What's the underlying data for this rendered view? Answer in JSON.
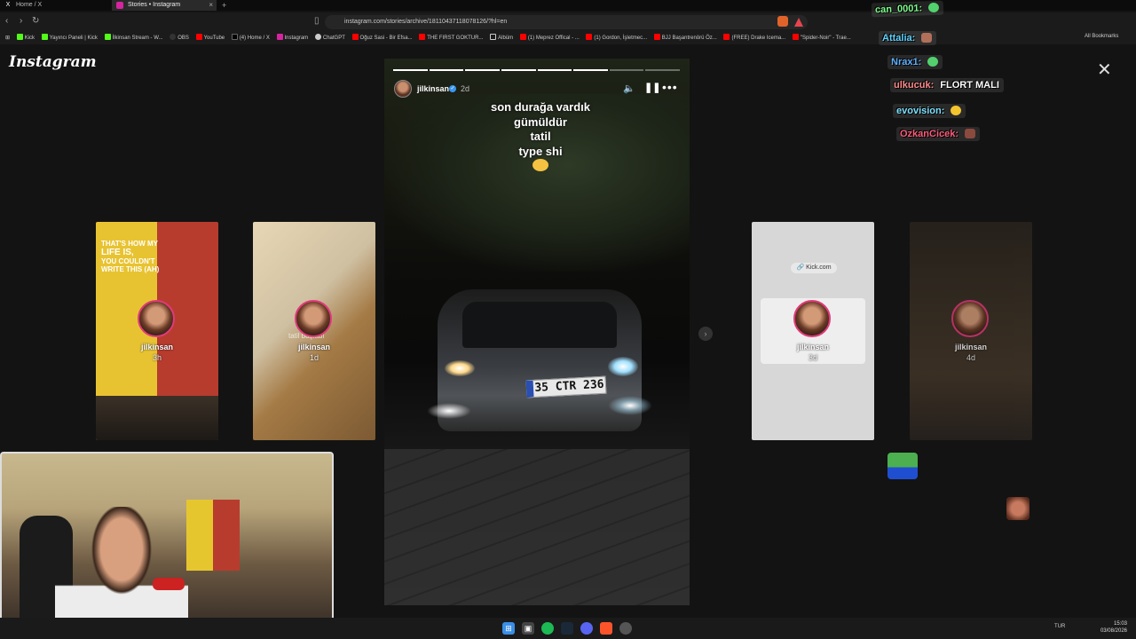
{
  "browser": {
    "tabs": [
      {
        "label": "Home / X",
        "icon": "x-logo-icon"
      },
      {
        "label": "Stories • Instagram",
        "icon": "instagram-icon"
      }
    ],
    "new_tab": "+",
    "url": "instagram.com/stories/archive/18110437118078126/?hl=en",
    "bookmarks": [
      "Kick",
      "Yayıncı Paneli | Kick",
      "İlkinsan Stream - W...",
      "OBS",
      "YouTube",
      "(4) Home / X",
      "Instagram",
      "ChatGPT",
      "Oğuz Sasi - Bir Efsa...",
      "THE FIRST GOKTUR...",
      "Albüm",
      "(1) Meprez Offical - ...",
      "(1) Gordon, İşletmec...",
      "BJJ Başantrenörü Öz...",
      "(FREE) Drake Icema...",
      "\"Spider-Noir\" - Trae..."
    ],
    "all_bookmarks": "All Bookmarks"
  },
  "instagram": {
    "logo": "Instagram",
    "close": "✕",
    "story": {
      "username": "jilkinsan",
      "time": "2d",
      "caption_lines": [
        "son durağa vardık",
        "gümüldür",
        "tatil",
        "type shi"
      ],
      "plate": "35 CTR 236",
      "progress_segments": 8,
      "progress_current": 6
    },
    "thumbnails": [
      {
        "username": "jilkinsan",
        "time": "3h",
        "quote_line1": "THAT'S HOW MY",
        "quote_big": "LIFE IS,",
        "quote_line3": "YOU COULDN'T WRITE THIS (AH)"
      },
      {
        "username": "jilkinsan",
        "time": "1d",
        "overlay": "tatil başladı"
      },
      {
        "username": "jilkinsan",
        "time": "3d",
        "pill": "🔗 Kick.com"
      },
      {
        "username": "jilkinsan",
        "time": "4d"
      }
    ]
  },
  "chat": [
    {
      "user": "can_0001:",
      "message": "",
      "color": "#7CFC8A"
    },
    {
      "user": "Attalia:",
      "message": "",
      "color": "#5fd3ff"
    },
    {
      "user": "Nrax1:",
      "message": "",
      "color": "#5fb0ff"
    },
    {
      "user": "ulkucuk:",
      "message": "FLORT MALI",
      "color": "#ff8a8a"
    },
    {
      "user": "evovision:",
      "message": "",
      "color": "#7fe0ff"
    },
    {
      "user": "OzkanCicek:",
      "message": "",
      "color": "#ff5b7a"
    }
  ],
  "taskbar": {
    "lang": "TUR",
    "time": "15:03",
    "date": "03/08/2026"
  },
  "colors": {
    "instagram_accent": "#e03a7a",
    "verified": "#3897f0",
    "kick_green": "#53fc18"
  }
}
